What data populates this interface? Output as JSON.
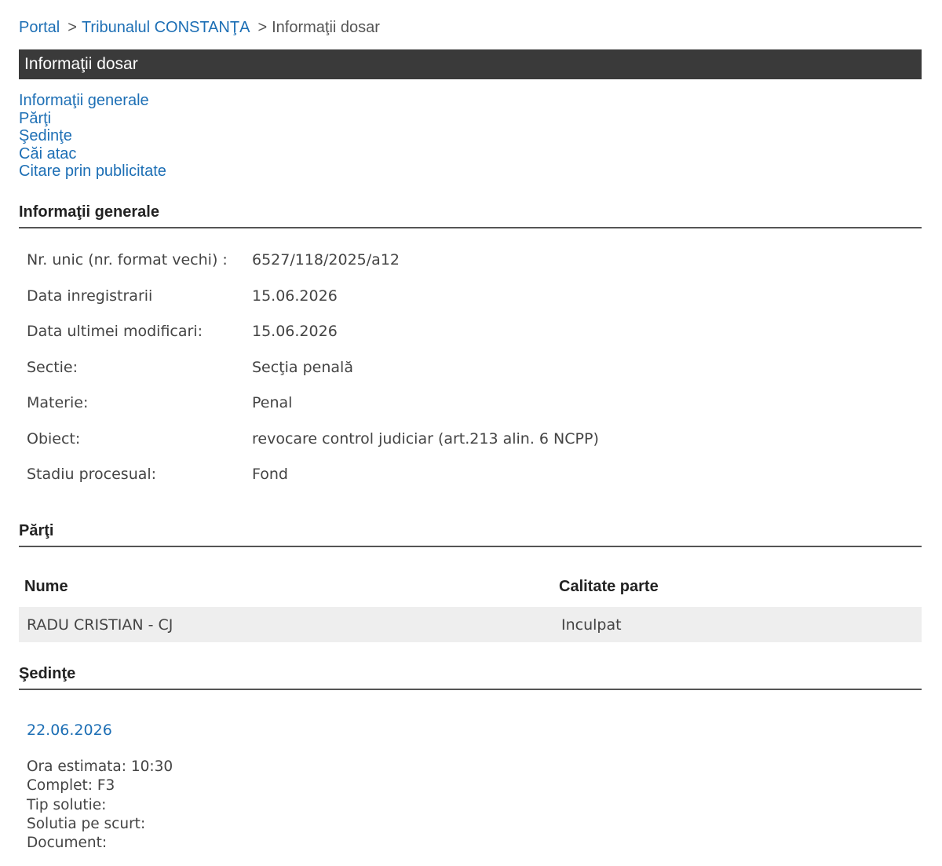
{
  "breadcrumb": {
    "portal": "Portal",
    "court": "Tribunalul CONSTANŢA",
    "current": "Informaţii dosar",
    "separator": ">"
  },
  "title": "Informaţii dosar",
  "nav": [
    "Informaţii generale",
    "Părţi",
    "Şedinţe",
    "Căi atac",
    "Citare prin publicitate"
  ],
  "general": {
    "heading": "Informaţii generale",
    "rows": [
      {
        "label": "Nr. unic (nr. format vechi) :",
        "value": "6527/118/2025/a12"
      },
      {
        "label": "Data inregistrarii",
        "value": "15.06.2026"
      },
      {
        "label": "Data ultimei modificari:",
        "value": "15.06.2026"
      },
      {
        "label": "Sectie:",
        "value": "Secţia penală"
      },
      {
        "label": "Materie:",
        "value": "Penal"
      },
      {
        "label": "Obiect:",
        "value": "revocare control judiciar (art.213 alin. 6 NCPP)"
      },
      {
        "label": "Stadiu procesual:",
        "value": "Fond"
      }
    ]
  },
  "parti": {
    "heading": "Părţi",
    "columns": [
      "Nume",
      "Calitate parte"
    ],
    "rows": [
      {
        "name": "RADU CRISTIAN - CJ",
        "role": "Inculpat"
      }
    ]
  },
  "sedinte": {
    "heading": "Şedinţe",
    "date": "22.06.2026",
    "details": [
      "Ora estimata: 10:30",
      "Complet: F3",
      "Tip solutie:",
      "Solutia pe scurt:",
      "Document:"
    ]
  }
}
